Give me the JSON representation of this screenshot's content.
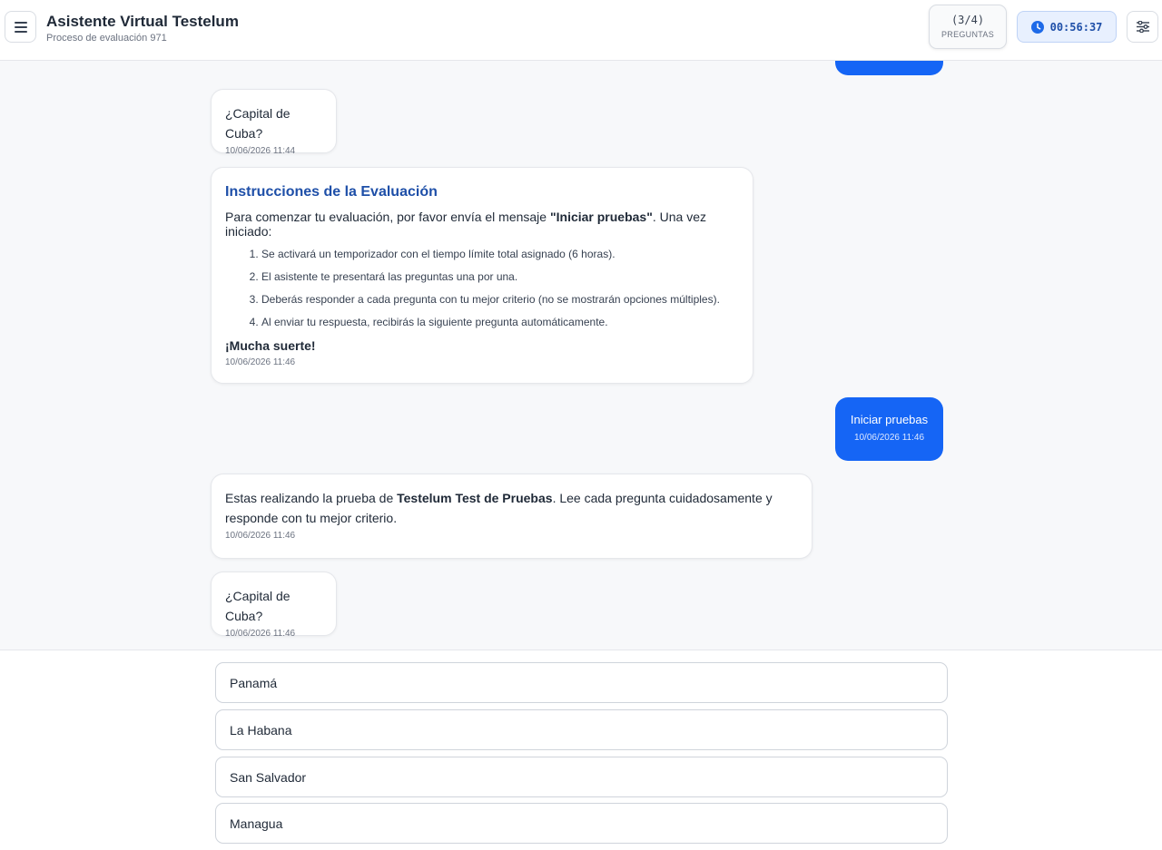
{
  "header": {
    "title": "Asistente Virtual Testelum",
    "subtitle": "Proceso de evaluación 971",
    "question_count": "(3/4)",
    "question_label": "PREGUNTAS",
    "timer": "00:56:37",
    "menu_icon": "hamburger-menu-icon",
    "clock_icon": "clock-icon",
    "settings_icon": "sliders-icon"
  },
  "messages": {
    "q1": {
      "text": "¿Capital de Cuba?",
      "time": "10/06/2026 11:44"
    },
    "instructions": {
      "title": "Instrucciones de la Evaluación",
      "intro_pre": "Para comenzar tu evaluación, por favor envía el mensaje ",
      "intro_bold": "\"Iniciar pruebas\"",
      "intro_post": ". Una vez iniciado:",
      "steps": [
        "Se activará un temporizador con el tiempo límite total asignado (6 horas).",
        "El asistente te presentará las preguntas una por una.",
        "Deberás responder a cada pregunta con tu mejor criterio (no se mostrarán opciones múltiples).",
        "Al enviar tu respuesta, recibirás la siguiente pregunta automáticamente."
      ],
      "luck": "¡Mucha suerte!",
      "time": "10/06/2026 11:46"
    },
    "user_start": {
      "text": "Iniciar pruebas",
      "time": "10/06/2026 11:46"
    },
    "intro": {
      "pre": "Estas realizando la prueba de ",
      "bold": "Testelum Test de Pruebas",
      "post": ". Lee cada pregunta cuidadosamente y responde con tu mejor criterio.",
      "time": "10/06/2026 11:46"
    },
    "q2": {
      "text": "¿Capital de Cuba?",
      "time": "10/06/2026 11:46"
    }
  },
  "options": [
    "Panamá",
    "La Habana",
    "San Salvador",
    "Managua"
  ],
  "colors": {
    "accent": "#1565f5",
    "title_blue": "#1e4fa8",
    "background": "#f7f8fa"
  }
}
